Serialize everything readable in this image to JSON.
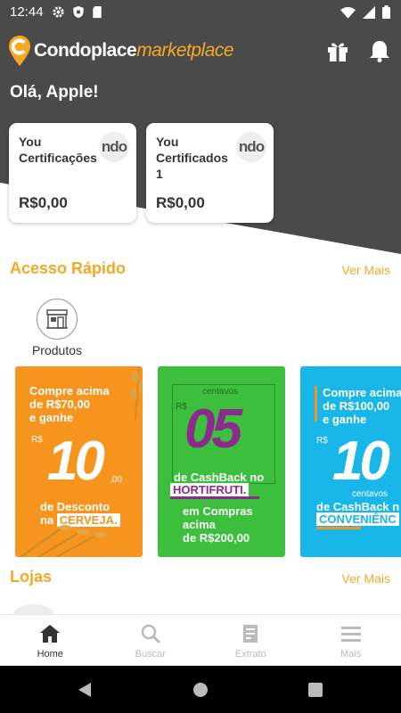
{
  "status_bar": {
    "time": "12:44"
  },
  "brand": {
    "name": "Condoplace",
    "suffix": "marketplace"
  },
  "greeting": "Olá, Apple!",
  "wallets": [
    {
      "title": "You Certificações",
      "logo_text": "ndo",
      "balance": "R$0,00"
    },
    {
      "title": "You Certificados 1",
      "logo_text": "ndo",
      "balance": "R$0,00"
    }
  ],
  "quick_access": {
    "title": "Acesso Rápido",
    "see_more": "Ver Mais",
    "items": [
      {
        "label": "Produtos",
        "icon": "storefront-icon"
      }
    ]
  },
  "banners": [
    {
      "bg": "#f7941d",
      "line1": "Compre acima",
      "line2": "de R$70,00",
      "line3": "e ganhe",
      "currency": "R$",
      "big": "10",
      "cents": ",00",
      "line4": "de Desconto",
      "line5_prefix": "na",
      "highlight": "CERVEJA."
    },
    {
      "bg": "#3cbf3c",
      "unit": "centavos",
      "currency": "R$",
      "big": "05",
      "line1": "de CashBack no",
      "highlight": "HORTIFRUTI.",
      "line2": "em Compras",
      "line3": "acima",
      "line4": "de R$200,00"
    },
    {
      "bg": "#19b6ea",
      "line1": "Compre acima",
      "line2": "de R$100,00",
      "line3": "e ganhe",
      "currency": "R$",
      "big": "10",
      "unit": "centavos",
      "line4": "de CashBack n",
      "highlight": "CONVENIÊNC"
    }
  ],
  "stores": {
    "title": "Lojas",
    "see_more": "Ver Mais"
  },
  "bottom_nav": [
    {
      "label": "Home",
      "icon": "home-icon",
      "active": true
    },
    {
      "label": "Buscar",
      "icon": "search-icon",
      "active": false
    },
    {
      "label": "Extrato",
      "icon": "receipt-icon",
      "active": false
    },
    {
      "label": "Mais",
      "icon": "menu-icon",
      "active": false
    }
  ],
  "colors": {
    "header": "#4a4a4a",
    "accent": "#f7a823"
  }
}
